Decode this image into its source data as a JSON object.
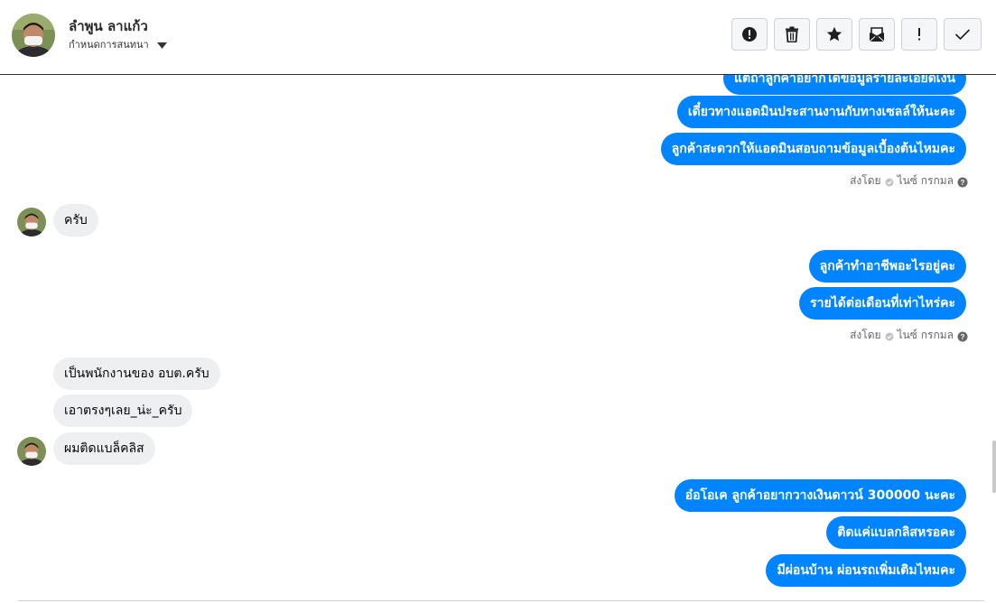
{
  "header": {
    "contact_name": "ลำพูน ลาแก้ว",
    "assign_label": "กำหนดการสนทนา",
    "actions": [
      "spam-icon",
      "trash-icon",
      "star-icon",
      "mail-icon",
      "important-icon",
      "check-icon"
    ]
  },
  "messages": {
    "m0": "แต่ถ้าลูกค้าอยากได้ข้อมูลรายละเอียดเงิน",
    "m1": "เดี๋ยวทางแอดมินประสานงานกับทางเซลล์ให้นะคะ",
    "m2": "ลูกค้าสะดวกให้แอดมินสอบถามข้อมูลเบื้องต้นไหมคะ",
    "seen1_prefix": "ส่งโดย",
    "seen1_name": "ไนซ์ กรกมล",
    "m3": "ครับ",
    "m4": "ลูกค้าทำอาชีพอะไรอยู่คะ",
    "m5": "รายได้ต่อเดือนที่เท่าไหร่คะ",
    "seen2_prefix": "ส่งโดย",
    "seen2_name": "ไนซ์ กรกมล",
    "m6": "เป็นพนักงานของ อบต.ครับ",
    "m7": "เอาตรงๆเลย_น่ะ_ครับ",
    "m8": "ผมติดแบล็คลิส",
    "m9": "อ๋อโอเค ลูกค้าอยากวางเงินดาวน์ 300000 นะคะ",
    "m10": "ติดแค่แบลกลิสหรอคะ",
    "m11": "มีผ่อนบ้าน ผ่อนรถเพิ่มเติมไหมคะ"
  },
  "colors": {
    "outgoing": "#0084ff",
    "incoming": "#eeeff1"
  }
}
